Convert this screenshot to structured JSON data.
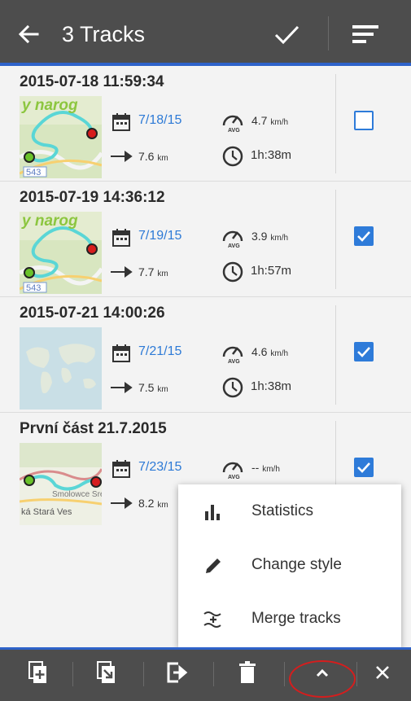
{
  "appbar": {
    "title": "3 Tracks"
  },
  "tracks": [
    {
      "name": "2015-07-18 11:59:34",
      "date": "7/18/15",
      "distance": "7.6",
      "distance_unit": "km",
      "speed": "4.7",
      "speed_unit": "km/h",
      "duration": "1h:38m",
      "checked": false,
      "map": "route-a"
    },
    {
      "name": "2015-07-19 14:36:12",
      "date": "7/19/15",
      "distance": "7.7",
      "distance_unit": "km",
      "speed": "3.9",
      "speed_unit": "km/h",
      "duration": "1h:57m",
      "checked": true,
      "map": "route-a"
    },
    {
      "name": "2015-07-21 14:00:26",
      "date": "7/21/15",
      "distance": "7.5",
      "distance_unit": "km",
      "speed": "4.6",
      "speed_unit": "km/h",
      "duration": "1h:38m",
      "checked": true,
      "map": "world"
    },
    {
      "name": "První část 21.7.2015",
      "date": "7/23/15",
      "distance": "8.2",
      "distance_unit": "km",
      "speed": "--",
      "speed_unit": "km/h",
      "duration": "",
      "checked": true,
      "map": "route-b"
    }
  ],
  "thumb_labels": {
    "map_a_text": "y narog",
    "map_a_number": "543",
    "map_b_town1": "Smolowce Sre",
    "map_b_town2": "ká Stará Ves"
  },
  "speed_badge": "AVG",
  "menu": {
    "items": [
      {
        "label": "Statistics",
        "icon": "bar-chart-icon"
      },
      {
        "label": "Change style",
        "icon": "pencil-icon"
      },
      {
        "label": "Merge tracks",
        "icon": "merge-icon"
      }
    ]
  },
  "bottombar": {
    "buttons": [
      "copy-icon",
      "move-icon",
      "export-icon",
      "delete-icon",
      "chevron-up-icon",
      "close-icon"
    ]
  },
  "colors": {
    "appbar": "#4d4d4d",
    "accent": "#2e62c9",
    "date_text": "#2d7ad6",
    "checkbox": "#2e7bd9",
    "highlight_circle": "#d61d1d"
  }
}
